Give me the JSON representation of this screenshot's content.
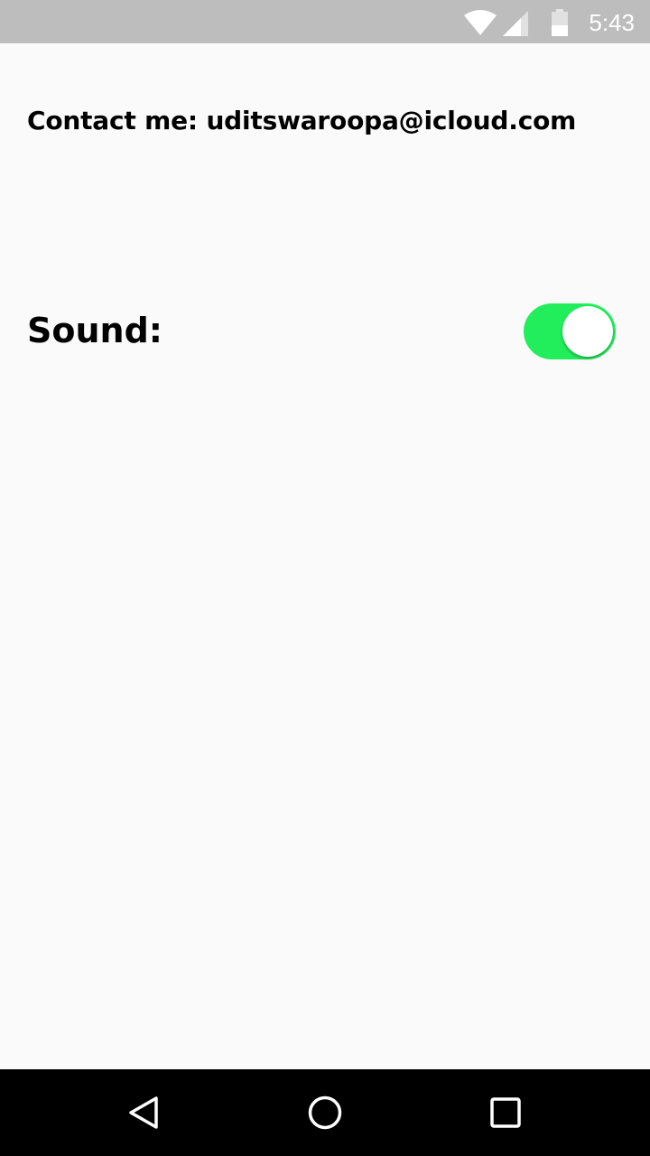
{
  "status_bar": {
    "time": "5:43",
    "icons": [
      "wifi-icon",
      "cell-signal-icon",
      "battery-icon"
    ]
  },
  "settings": {
    "contact_text": "Contact me: uditswaroopa@icloud.com",
    "sound_label": "Sound:",
    "sound_enabled": true
  },
  "nav_bar": {
    "buttons": [
      "back-icon",
      "home-icon",
      "recents-icon"
    ]
  },
  "colors": {
    "status_bar": "#bdbdbd",
    "background": "#fafafa",
    "toggle_on": "#22ee5b",
    "nav_bar": "#000000"
  }
}
